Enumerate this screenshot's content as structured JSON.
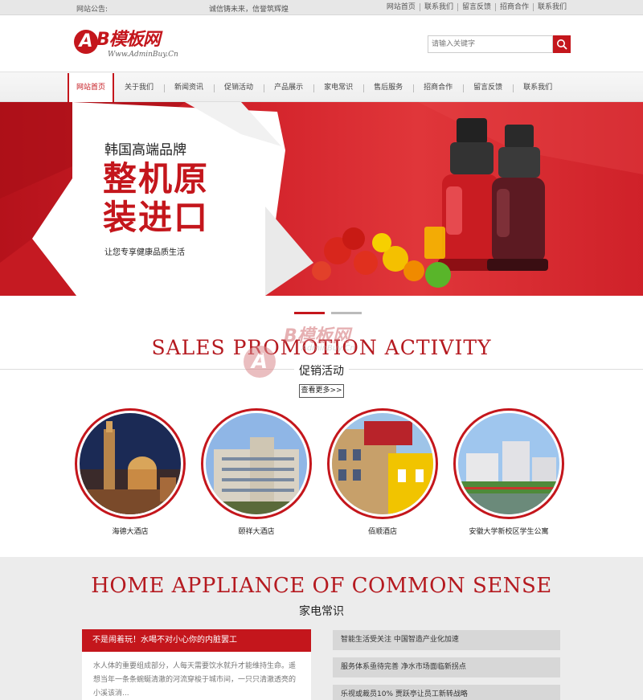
{
  "topbar": {
    "notice_label": "网站公告:",
    "notice_text": "诚信铸未来，信誉筑辉煌",
    "links": [
      "网站首页",
      "联系我们",
      "留言反馈",
      "招商合作",
      "联系我们"
    ]
  },
  "header": {
    "logo_letter": "A",
    "logo_brand": "B模板网",
    "logo_site": "Www.AdminBuy.Cn",
    "search_placeholder": "请输入关键字"
  },
  "nav": {
    "items": [
      "网站首页",
      "关于我们",
      "新闻资讯",
      "促销活动",
      "产品展示",
      "家电常识",
      "售后服务",
      "招商合作",
      "留言反馈",
      "联系我们"
    ],
    "active_index": 0
  },
  "banner": {
    "subtitle": "韩国高端品牌",
    "headline_line1": "整机原",
    "headline_line2": "装进口",
    "slogan": "让您专享健康品质生活",
    "slides_total": 2,
    "slides_active": 1
  },
  "watermark": {
    "letter": "A",
    "text": "B模板网",
    "site": "AdminBuy.Cn"
  },
  "promo": {
    "title_en": "SALES PROMOTION ACTIVITY",
    "title_cn": "促销活动",
    "more": "查看更多>>",
    "hotels": [
      {
        "name": "海德大酒店"
      },
      {
        "name": "颐祥大酒店"
      },
      {
        "name": "佰顺酒店"
      },
      {
        "name": "安徽大学新校区学生公寓"
      }
    ]
  },
  "knowledge": {
    "title_en": "HOME APPLIANCE OF COMMON SENSE",
    "title_cn": "家电常识",
    "featured": {
      "title": "不是闹着玩！水喝不对小心你的内脏罢工",
      "excerpt": "水人体的重要组成部分，人每天需要饮水就升才能维持生命。遥想当年一条条蜿蜒清澈的河流穿梭于城市间，一只只清澈透亮的小溪该消..."
    },
    "list": [
      "智能生活受关注 中国智造产业化加速",
      "服务体系亟待完善 净水市场面临新拐点",
      "乐视或裁员10% 贾跃亭让员工新转战略"
    ]
  },
  "colors": {
    "accent": "#c4161c",
    "topbar_bg": "#e7e7e7",
    "section_bg": "#ececec",
    "list_item_bg": "#d7d7d7"
  }
}
